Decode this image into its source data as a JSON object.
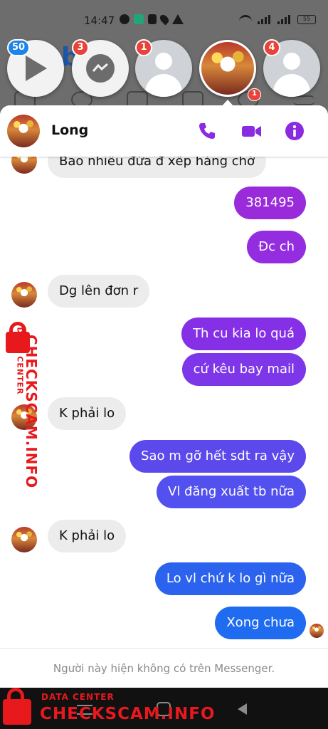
{
  "status_bar": {
    "time": "14:47",
    "battery": "55",
    "icons": [
      "facebook-icon",
      "app-icon",
      "tiktok-icon",
      "location-icon",
      "warning-icon",
      "wifi-icon",
      "signal-icon",
      "signal-icon"
    ]
  },
  "chat_heads": [
    {
      "name": "video-chat-head",
      "badge": "50",
      "badge_color": "#1f84e8"
    },
    {
      "name": "messenger-chat-head",
      "badge": "3",
      "badge_color": "#e8433a"
    },
    {
      "name": "contact-chat-head-1",
      "badge": "1",
      "badge_color": "#e8433a"
    },
    {
      "name": "long-chat-head",
      "badge": "",
      "badge_color": ""
    },
    {
      "name": "contact-chat-head-2",
      "badge": "4",
      "badge_color": "#e8433a"
    }
  ],
  "background_app": {
    "logo_fragment": "b",
    "notification_count": "1"
  },
  "chat": {
    "contact_name": "Long",
    "header_icons": [
      "phone-icon",
      "video-call-icon",
      "info-icon"
    ],
    "accent_color": "#8a2be2",
    "messages": [
      {
        "from": "them",
        "text": "Bao nhiêu đứa đ xếp hàng chờ"
      },
      {
        "from": "me",
        "text": "381495"
      },
      {
        "from": "me",
        "text": "Đc ch"
      },
      {
        "from": "them",
        "text": "Dg lên đơn r"
      },
      {
        "from": "me",
        "text": "Th cu kia lo quá"
      },
      {
        "from": "me",
        "text": "cứ kêu bay mail"
      },
      {
        "from": "them",
        "text": "K phải lo"
      },
      {
        "from": "me",
        "text": "Sao m gỡ hết sdt ra vậy"
      },
      {
        "from": "me",
        "text": "Vl đăng xuất tb nữa"
      },
      {
        "from": "them",
        "text": "K phải lo"
      },
      {
        "from": "me",
        "text": "Lo vl chứ k lo gì nữa"
      },
      {
        "from": "me",
        "text": "Xong chưa"
      }
    ],
    "footer_notice": "Người này hiện không có trên Messenger."
  },
  "watermark": {
    "small": "DATA CENTER",
    "big": "CHECKSCAM.INFO",
    "color": "#e8191d"
  }
}
